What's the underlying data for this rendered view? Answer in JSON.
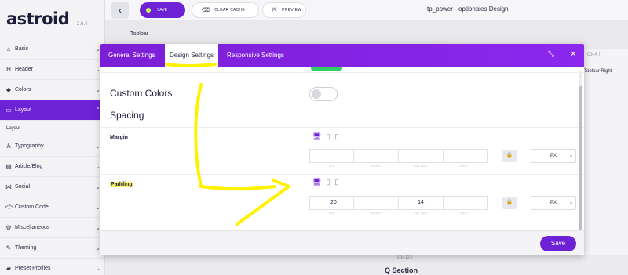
{
  "sidebar": {
    "logo": "astroid",
    "version": "2.6.4",
    "items": [
      {
        "label": "Basic",
        "icon": "home-icon"
      },
      {
        "label": "Header",
        "icon": "header-icon"
      },
      {
        "label": "Colors",
        "icon": "tint-icon"
      },
      {
        "label": "Layout",
        "icon": "layout-icon",
        "active": true
      },
      {
        "label": "Typography",
        "icon": "font-icon"
      },
      {
        "label": "Article/Blog",
        "icon": "article-icon"
      },
      {
        "label": "Social",
        "icon": "share-icon"
      },
      {
        "label": "Custom Code",
        "icon": "code-icon"
      },
      {
        "label": "Miscellaneous",
        "icon": "gears-icon"
      },
      {
        "label": "Theming",
        "icon": "brush-icon"
      },
      {
        "label": "Preset Profiles",
        "icon": "folder-icon"
      }
    ],
    "sub_item": "Layout"
  },
  "topbar": {
    "save_label": "SAVE",
    "clear_cache_label": "CLEAR CACHE",
    "preview_label": "PREVIEW",
    "page_title": "tp_power - optionales Design",
    "toolbar_label": "Toolbar"
  },
  "background": {
    "right_text_1": "col-4 /",
    "right_text_2": "Toolbar Right",
    "bottom_text": "col-12 /",
    "bottom_title": "Q Section"
  },
  "modal": {
    "tabs": [
      "General Settings",
      "Design Settings",
      "Responsive Settings"
    ],
    "active_tab": "Design Settings",
    "custom_colors_label": "Custom Colors",
    "spacing_label": "Spacing",
    "margin": {
      "label": "Margin",
      "top": "",
      "right": "",
      "bottom": "",
      "left": "",
      "unit": "PX"
    },
    "padding": {
      "label": "Padding",
      "top": "20",
      "right": "",
      "bottom": "14",
      "left": "",
      "unit": "PX"
    },
    "captions": [
      "TOP",
      "RIGHT",
      "BOTTOM",
      "LEFT"
    ],
    "save_label": "Save"
  },
  "colors": {
    "accent": "#6e22d6",
    "highlight": "#fff200",
    "toggle_on": "#2fcf63"
  }
}
